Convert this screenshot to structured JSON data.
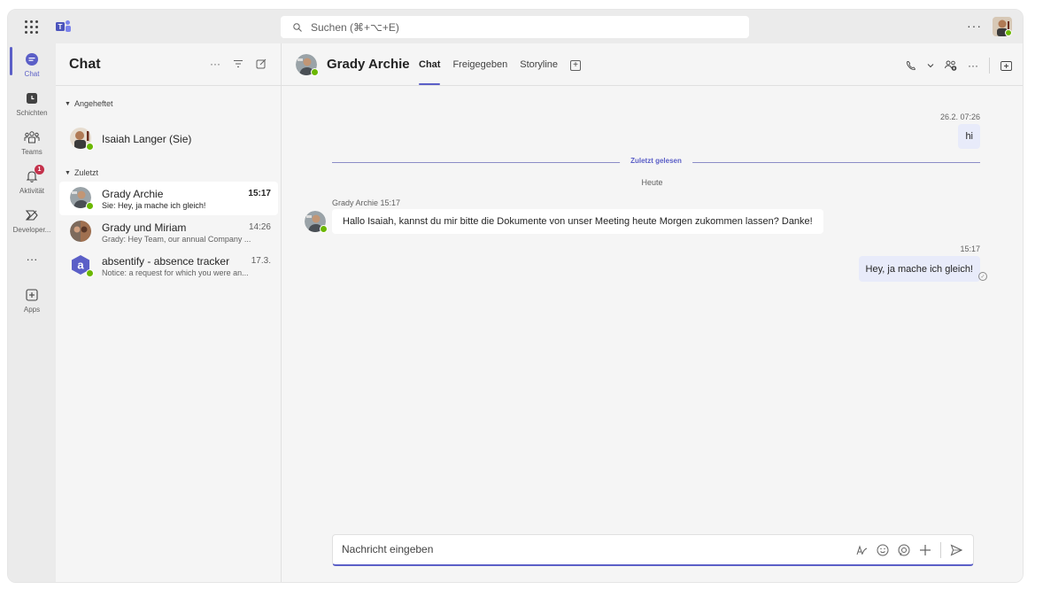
{
  "titlebar": {
    "search_placeholder": "Suchen (⌘+⌥+E)",
    "more_label": "···"
  },
  "rail": {
    "items": [
      {
        "label": "Chat",
        "icon": "chat-icon"
      },
      {
        "label": "Schichten",
        "icon": "shifts-icon"
      },
      {
        "label": "Teams",
        "icon": "teams-icon"
      },
      {
        "label": "Aktivität",
        "icon": "bell-icon",
        "badge": "1"
      },
      {
        "label": "Developer...",
        "icon": "developer-icon"
      },
      {
        "label": "···",
        "icon": "more-icon"
      },
      {
        "label": "Apps",
        "icon": "apps-icon"
      }
    ]
  },
  "list": {
    "title": "Chat",
    "pinned_section": "Angeheftet",
    "recent_section": "Zuletzt",
    "pinned": [
      {
        "name": "Isaiah Langer (Sie)"
      }
    ],
    "recent": [
      {
        "name": "Grady Archie",
        "time": "15:17",
        "preview": "Sie: Hey, ja mache ich gleich!"
      },
      {
        "name": "Grady und Miriam",
        "time": "14:26",
        "preview": "Grady: Hey Team, our annual Company ..."
      },
      {
        "name": "absentify - absence tracker",
        "time": "17.3.",
        "preview": "Notice: a request for which you were an..."
      }
    ]
  },
  "conversation": {
    "contact_name": "Grady Archie",
    "tabs": [
      "Chat",
      "Freigegeben",
      "Storyline"
    ],
    "active_tab": "Chat",
    "messages": {
      "first_time": "26.2. 07:26",
      "first_text": "hi",
      "divider_label": "Zuletzt gelesen",
      "day_label": "Heute",
      "incoming_meta": "Grady Archie  15:17",
      "incoming_text": "Hallo Isaiah, kannst du mir bitte die Dokumente von unser Meeting heute Morgen zukommen lassen? Danke!",
      "reply_time": "15:17",
      "reply_text": "Hey, ja mache ich gleich!"
    },
    "composer_placeholder": "Nachricht eingeben"
  },
  "colors": {
    "accent": "#5b5fc7",
    "presence_available": "#6bb700",
    "badge": "#c4314b",
    "my_bubble": "#e8ebfa"
  }
}
